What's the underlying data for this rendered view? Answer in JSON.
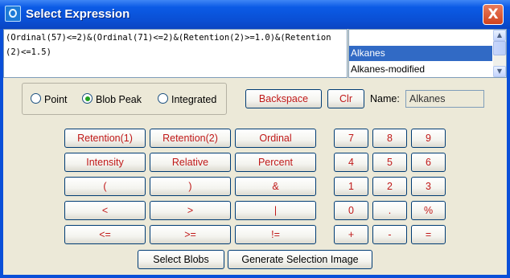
{
  "window": {
    "title": "Select Expression",
    "close_label": "X"
  },
  "expression": {
    "value": "(Ordinal(57)<=2)&(Ordinal(71)<=2)&(Retention(2)>=1.0)&(Retention(2)<=1.5)"
  },
  "list": {
    "items": [
      {
        "label": "Alkanes"
      },
      {
        "label": "Alkanes-modified"
      }
    ],
    "selected": "Alkanes"
  },
  "radio": {
    "options": [
      {
        "label": "Point"
      },
      {
        "label": "Blob Peak"
      },
      {
        "label": "Integrated"
      }
    ],
    "selected": "Blob Peak"
  },
  "actions": {
    "backspace": "Backspace",
    "clear": "Clr"
  },
  "name": {
    "label": "Name:",
    "value": "Alkanes"
  },
  "function_buttons": [
    [
      "Retention(1)",
      "Retention(2)",
      "Ordinal"
    ],
    [
      "Intensity",
      "Relative",
      "Percent"
    ],
    [
      "(",
      ")",
      "&"
    ],
    [
      "<",
      ">",
      "|"
    ],
    [
      "<=",
      ">=",
      "!="
    ]
  ],
  "keypad": [
    [
      "7",
      "8",
      "9"
    ],
    [
      "4",
      "5",
      "6"
    ],
    [
      "1",
      "2",
      "3"
    ],
    [
      "0",
      ".",
      "%"
    ],
    [
      "+",
      "-",
      "="
    ]
  ],
  "bottom": {
    "select_blobs": "Select Blobs",
    "generate": "Generate Selection Image"
  },
  "colors": {
    "title_bar": "#0a4fd8",
    "client_bg": "#ece9d8",
    "accent_text": "#c01818",
    "list_selected": "#316ac5",
    "radio_dot": "#21a121"
  },
  "icons": [
    "app-icon",
    "close-icon",
    "scroll-up-icon",
    "scroll-down-icon"
  ]
}
